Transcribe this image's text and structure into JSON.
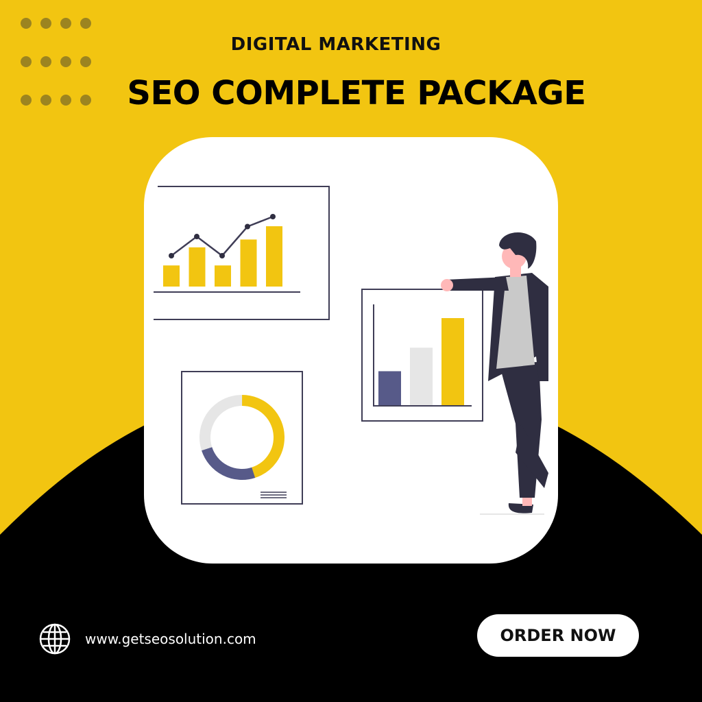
{
  "header": {
    "kicker": "DIGITAL MARKETING",
    "title": "SEO COMPLETE PACKAGE"
  },
  "footer": {
    "website": "www.getseosolution.com",
    "cta_label": "ORDER NOW"
  },
  "icons": {
    "website": "globe-icon"
  },
  "colors": {
    "background_yellow": "#f2c511",
    "background_black": "#000000",
    "card_white": "#ffffff",
    "accent_yellow": "#f2c511",
    "slate_blue": "#575a89",
    "dark_suit": "#2f2e41",
    "light_gray": "#e6e6e6",
    "dot_olive": "#9c8420"
  },
  "illustration": {
    "line_bar_chart": {
      "bars": [
        0.35,
        0.65,
        0.35,
        0.78,
        1.0
      ],
      "line": [
        0.45,
        0.72,
        0.45,
        0.86,
        1.0
      ]
    },
    "column_chart": {
      "bars": [
        0.39,
        0.66,
        1.0
      ]
    },
    "donut_chart": {
      "segments": [
        0.45,
        0.25,
        0.3
      ]
    }
  }
}
